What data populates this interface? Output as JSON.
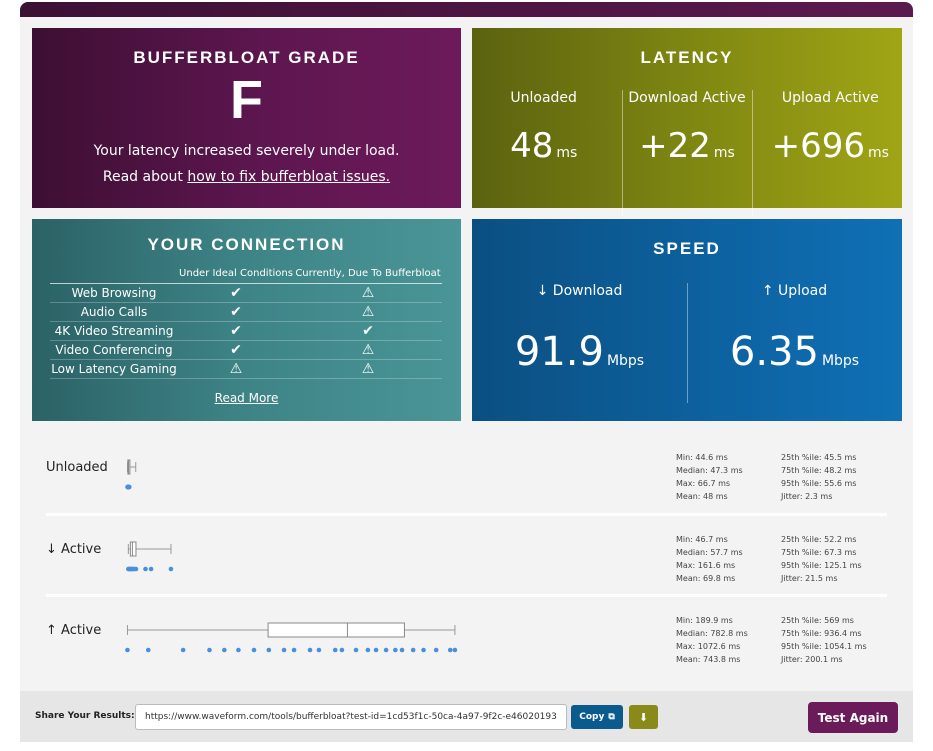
{
  "grade": {
    "title": "BUFFERBLOAT GRADE",
    "letter": "F",
    "message": "Your latency increased severely under load.",
    "read_prefix": "Read about ",
    "link_text": "how to fix bufferbloat issues."
  },
  "latency": {
    "title": "LATENCY",
    "cols": [
      {
        "label": "Unloaded",
        "value": "48",
        "unit": "ms"
      },
      {
        "label": "Download Active",
        "value": "+22",
        "unit": "ms"
      },
      {
        "label": "Upload Active",
        "value": "+696",
        "unit": "ms"
      }
    ]
  },
  "connection": {
    "title": "YOUR CONNECTION",
    "header_ideal": "Under Ideal Conditions",
    "header_current": "Currently, Due To Bufferbloat",
    "rows": [
      {
        "name": "Web Browsing",
        "ideal": "check",
        "current": "warning"
      },
      {
        "name": "Audio Calls",
        "ideal": "check",
        "current": "warning"
      },
      {
        "name": "4K Video Streaming",
        "ideal": "check",
        "current": "check"
      },
      {
        "name": "Video Conferencing",
        "ideal": "check",
        "current": "warning"
      },
      {
        "name": "Low Latency Gaming",
        "ideal": "warning",
        "current": "warning"
      }
    ],
    "read_more": "Read More"
  },
  "speed": {
    "title": "SPEED",
    "download_label": "↓ Download",
    "download_value": "91.9",
    "upload_label": "↑ Upload",
    "upload_value": "6.35",
    "unit": "Mbps"
  },
  "latency_rows": [
    {
      "label": "Unloaded",
      "stats_left": [
        "Min: 44.6 ms",
        "Median: 47.3 ms",
        "Max: 66.7 ms",
        "Mean: 48 ms"
      ],
      "stats_right": [
        "25th %ile: 45.5 ms",
        "75th %ile: 48.2 ms",
        "95th %ile: 55.6 ms",
        "Jitter: 2.3 ms"
      ],
      "box": {
        "min": 44.6,
        "q1": 45.5,
        "median": 47.3,
        "q3": 48.2,
        "max": 66.7
      },
      "points": [
        44.6,
        45.0,
        45.3,
        45.6,
        46.0,
        46.4,
        46.8,
        47.3,
        47.7,
        48.2,
        48.6,
        49.3
      ]
    },
    {
      "label": "↓ Active",
      "stats_left": [
        "Min: 46.7 ms",
        "Median: 57.7 ms",
        "Max: 161.6 ms",
        "Mean: 69.8 ms"
      ],
      "stats_right": [
        "25th %ile: 52.2 ms",
        "75th %ile: 67.3 ms",
        "95th %ile: 125.1 ms",
        "Jitter: 21.5 ms"
      ],
      "box": {
        "min": 46.7,
        "q1": 52.2,
        "median": 57.7,
        "q3": 67.3,
        "max": 161.6
      },
      "points": [
        46.7,
        48.5,
        50.5,
        52.2,
        54.0,
        56.0,
        57.7,
        60.0,
        63.0,
        67.3,
        93.0,
        108.0,
        161.6
      ]
    },
    {
      "label": "↑ Active",
      "stats_left": [
        "Min: 189.9 ms",
        "Median: 782.8 ms",
        "Max: 1072.6 ms",
        "Mean: 743.8 ms"
      ],
      "stats_right": [
        "25th %ile: 569 ms",
        "75th %ile: 936.4 ms",
        "95th %ile: 1054.1 ms",
        "Jitter: 200.1 ms"
      ],
      "box": {
        "min": 189.9,
        "q1": 569,
        "median": 782.8,
        "q3": 936.4,
        "max": 1072.6
      },
      "points": [
        189.9,
        246,
        340,
        411,
        451,
        489,
        531,
        571,
        612,
        639,
        682,
        706,
        750,
        768,
        806,
        838,
        860,
        887,
        912,
        930,
        960,
        988,
        1022,
        1060,
        1072.6
      ]
    }
  ],
  "share": {
    "label": "Share Your Results:",
    "url": "https://www.waveform.com/tools/bufferbloat?test-id=1cd53f1c-50ca-4a97-9f2c-e46020193",
    "copy_label": "Copy",
    "again_label": "Test Again"
  },
  "colors": {
    "grade_bg": "#5e1650",
    "latency_bg": "#7e8612",
    "connection_bg": "#3e8487",
    "speed_bg": "#0d63a2",
    "point": "#4a8fdc",
    "button_again": "#6b1a5a"
  }
}
